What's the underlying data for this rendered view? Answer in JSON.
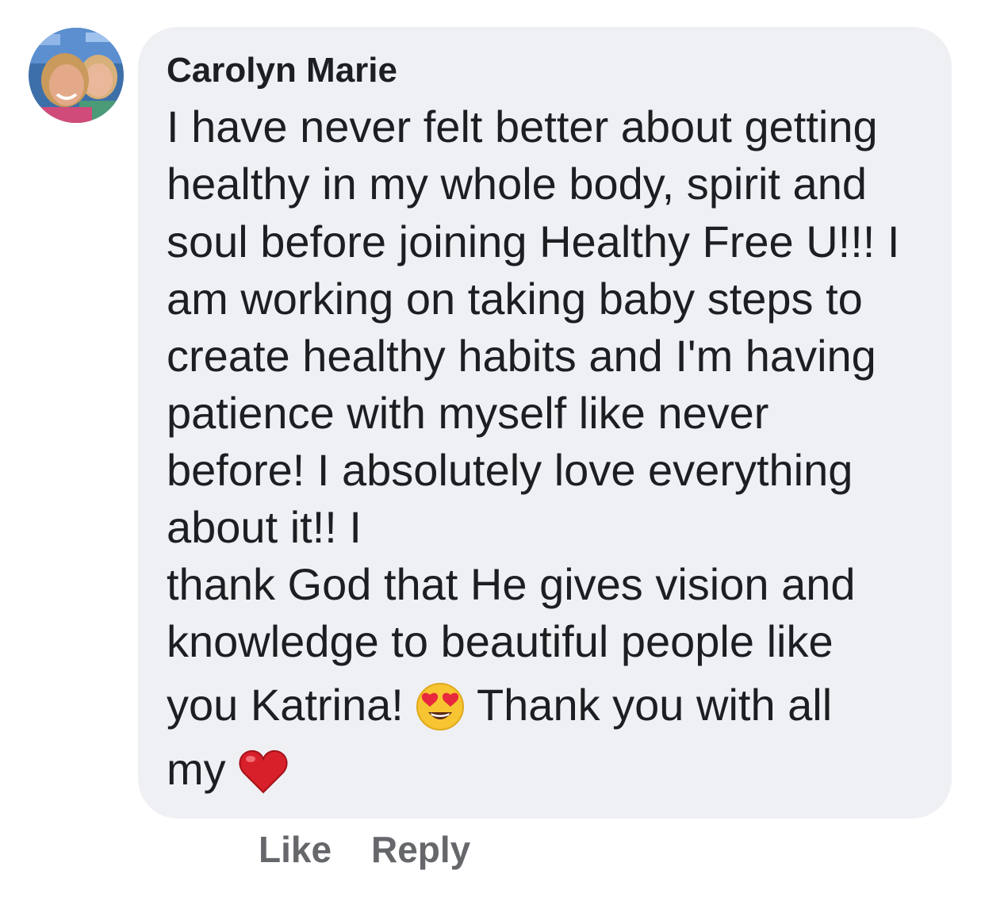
{
  "comment": {
    "author": "Carolyn Marie",
    "lines": [
      "I have never felt better about getting",
      "healthy in my whole body, spirit and",
      "soul before joining Healthy Free U!!! I",
      "am working on taking baby steps to",
      "create healthy habits and I'm having",
      "patience with myself like never",
      "before!  I absolutely love everything",
      "about it!!  I",
      "thank God that He gives vision and",
      "knowledge to beautiful people like"
    ],
    "line_11_before": "you Katrina!",
    "line_11_after": "Thank you with all",
    "line_12": "my",
    "emoji_1": "heart-eyes-emoji",
    "emoji_2": "red-heart-emoji"
  },
  "actions": {
    "timestamp": "",
    "like_label": "Like",
    "reply_label": "Reply",
    "color": "#65676b"
  },
  "colors": {
    "bubble": "#eff0f3",
    "text": "#1c1e21"
  }
}
